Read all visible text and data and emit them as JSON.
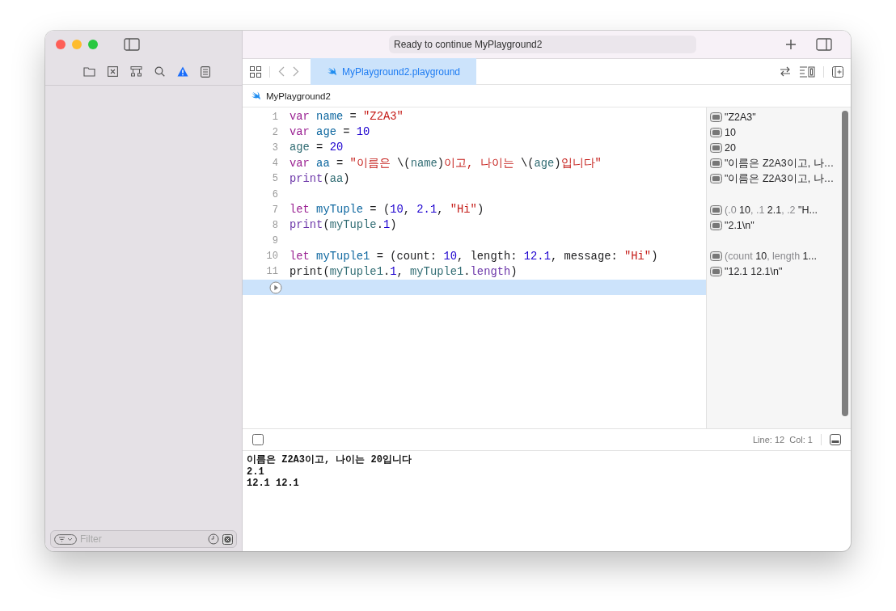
{
  "window": {
    "status": "Ready to continue MyPlayground2"
  },
  "tab": {
    "label": "MyPlayground2.playground",
    "selected": true
  },
  "breadcrumb": "MyPlayground2",
  "code_lines": [
    {
      "number": "1",
      "current": false,
      "tokens": [
        {
          "kind": "keyword",
          "text": "var"
        },
        {
          "kind": "decl",
          "text": " name"
        },
        {
          "kind": "plain",
          "text": " = "
        },
        {
          "kind": "string",
          "text": "\"Z2A3\""
        }
      ],
      "result": [
        {
          "kind": "value",
          "text": "\"Z2A3\""
        }
      ]
    },
    {
      "number": "2",
      "current": false,
      "tokens": [
        {
          "kind": "keyword",
          "text": "var"
        },
        {
          "kind": "decl",
          "text": " age"
        },
        {
          "kind": "plain",
          "text": " = "
        },
        {
          "kind": "number",
          "text": "10"
        }
      ],
      "result": [
        {
          "kind": "value",
          "text": "10"
        }
      ]
    },
    {
      "number": "3",
      "current": false,
      "tokens": [
        {
          "kind": "ident",
          "text": "age"
        },
        {
          "kind": "plain",
          "text": " = "
        },
        {
          "kind": "number",
          "text": "20"
        }
      ],
      "result": [
        {
          "kind": "value",
          "text": "20"
        }
      ]
    },
    {
      "number": "4",
      "current": false,
      "tokens": [
        {
          "kind": "keyword",
          "text": "var"
        },
        {
          "kind": "decl",
          "text": " aa"
        },
        {
          "kind": "plain",
          "text": " = "
        },
        {
          "kind": "string",
          "text": "\"이름은 "
        },
        {
          "kind": "plain",
          "text": "\\("
        },
        {
          "kind": "ident",
          "text": "name"
        },
        {
          "kind": "plain",
          "text": ")"
        },
        {
          "kind": "string",
          "text": "이고, 나이는 "
        },
        {
          "kind": "plain",
          "text": "\\("
        },
        {
          "kind": "ident",
          "text": "age"
        },
        {
          "kind": "plain",
          "text": ")"
        },
        {
          "kind": "string",
          "text": "입니다\""
        }
      ],
      "result": [
        {
          "kind": "value",
          "text": "\"이름은 Z2A3이고, 나…"
        }
      ]
    },
    {
      "number": "5",
      "current": false,
      "tokens": [
        {
          "kind": "func",
          "text": "print"
        },
        {
          "kind": "plain",
          "text": "("
        },
        {
          "kind": "ident",
          "text": "aa"
        },
        {
          "kind": "plain",
          "text": ")"
        }
      ],
      "result": [
        {
          "kind": "value",
          "text": "\"이름은 Z2A3이고, 나…"
        }
      ]
    },
    {
      "number": "6",
      "current": false
    },
    {
      "number": "7",
      "current": false,
      "tokens": [
        {
          "kind": "keyword",
          "text": "let"
        },
        {
          "kind": "decl",
          "text": " myTuple"
        },
        {
          "kind": "plain",
          "text": " = ("
        },
        {
          "kind": "number",
          "text": "10"
        },
        {
          "kind": "plain",
          "text": ", "
        },
        {
          "kind": "number",
          "text": "2.1"
        },
        {
          "kind": "plain",
          "text": ", "
        },
        {
          "kind": "string",
          "text": "\"Hi\""
        },
        {
          "kind": "plain",
          "text": ")"
        }
      ],
      "result": [
        {
          "kind": "label",
          "text": "(.0 "
        },
        {
          "kind": "value",
          "text": "10"
        },
        {
          "kind": "label",
          "text": ", .1 "
        },
        {
          "kind": "value",
          "text": "2.1"
        },
        {
          "kind": "label",
          "text": ", .2 "
        },
        {
          "kind": "value",
          "text": "\"H..."
        }
      ]
    },
    {
      "number": "8",
      "current": false,
      "tokens": [
        {
          "kind": "func",
          "text": "print"
        },
        {
          "kind": "plain",
          "text": "("
        },
        {
          "kind": "ident",
          "text": "myTuple"
        },
        {
          "kind": "plain",
          "text": "."
        },
        {
          "kind": "number",
          "text": "1"
        },
        {
          "kind": "plain",
          "text": ")"
        }
      ],
      "result": [
        {
          "kind": "value",
          "text": "\"2.1\\n\""
        }
      ]
    },
    {
      "number": "9",
      "current": false
    },
    {
      "number": "10",
      "current": false,
      "tokens": [
        {
          "kind": "keyword",
          "text": "let"
        },
        {
          "kind": "decl",
          "text": " myTuple1"
        },
        {
          "kind": "plain",
          "text": " = (count: "
        },
        {
          "kind": "number",
          "text": "10"
        },
        {
          "kind": "plain",
          "text": ", length: "
        },
        {
          "kind": "number",
          "text": "12.1"
        },
        {
          "kind": "plain",
          "text": ", message: "
        },
        {
          "kind": "string",
          "text": "\"Hi\""
        },
        {
          "kind": "plain",
          "text": ")"
        }
      ],
      "result": [
        {
          "kind": "label",
          "text": "(count "
        },
        {
          "kind": "value",
          "text": "10"
        },
        {
          "kind": "label",
          "text": ", length "
        },
        {
          "kind": "value",
          "text": "1..."
        }
      ]
    },
    {
      "number": "11",
      "current": false,
      "tokens": [
        {
          "kind": "plain",
          "text": "print("
        },
        {
          "kind": "ident",
          "text": "myTuple1"
        },
        {
          "kind": "plain",
          "text": "."
        },
        {
          "kind": "number",
          "text": "1"
        },
        {
          "kind": "plain",
          "text": ", "
        },
        {
          "kind": "ident",
          "text": "myTuple1"
        },
        {
          "kind": "plain",
          "text": "."
        },
        {
          "kind": "func",
          "text": "length"
        },
        {
          "kind": "plain",
          "text": ")"
        }
      ],
      "result": [
        {
          "kind": "value",
          "text": "\"12.1 12.1\\n\""
        }
      ]
    },
    {
      "current": true
    }
  ],
  "debug_bar": {
    "position": "Line: 12  Col: 1"
  },
  "console": [
    "이름은 Z2A3이고, 나이는 20입니다",
    "2.1",
    "12.1 12.1"
  ],
  "filter": {
    "placeholder": "Filter"
  }
}
